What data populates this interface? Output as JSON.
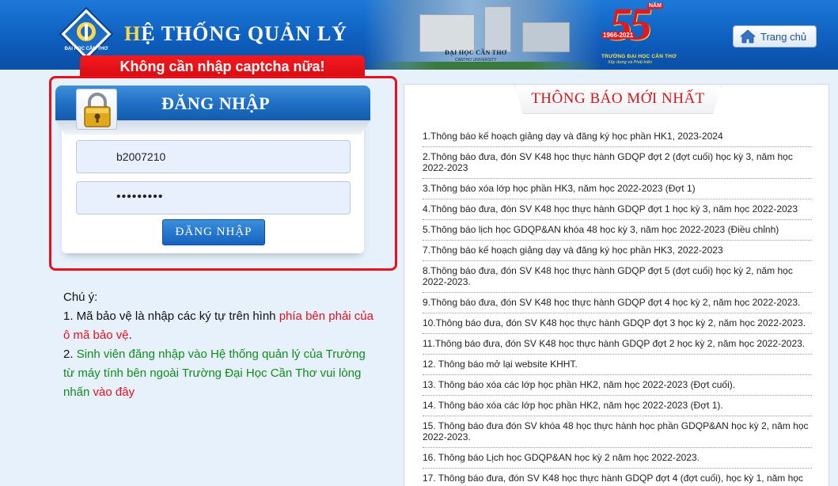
{
  "header": {
    "title_first": "H",
    "title_rest": "Ệ THỐNG QUẢN LÝ",
    "photo_sign": "ĐẠI HỌC CẦN THƠ",
    "photo_sub": "CANTHO UNIVERSITY",
    "anniversary": {
      "number": "55",
      "badge": "NĂM",
      "years": "1966-2021",
      "caption": "TRƯỜNG ĐẠI HỌC CẦN THƠ",
      "slogan": "Xây dựng và Phát triển"
    },
    "home_button": {
      "label": "Trang chủ",
      "icon": "home-icon"
    },
    "logo": {
      "text": "ĐẠI HỌC CẦN THƠ"
    }
  },
  "ribbon": {
    "text": "Không cần nhập captcha nữa!"
  },
  "login": {
    "title": "ĐĂNG NHẬP",
    "username_value": "b2007210",
    "password_value": "•••••••••",
    "submit_label": "ĐĂNG NHẬP",
    "icon": "padlock-icon"
  },
  "notes": {
    "heading": "Chú ý:",
    "n1_prefix": "1. Mã bảo vệ là nhập các ký tự trên hình ",
    "n1_red": "phía bên phải của ô mã bảo vệ",
    "n1_end": ".",
    "n2_prefix": "2. ",
    "n2_green": "Sinh viên đăng nhập vào Hệ thống quản lý của Trường từ máy tính bên ngoài Trường Đại Học Cần Thơ vui lòng nhấn ",
    "n2_link": "vào đây"
  },
  "announcements": {
    "title": "THÔNG BÁO MỚI NHẤT",
    "items": [
      "1.Thông báo kế hoạch giảng dạy và đăng ký học phần HK1, 2023-2024",
      "2.Thông báo đưa, đón SV K48 học thực hành GDQP đợt 2 (đợt cuối) học kỳ 3, năm học 2022-2023",
      "3.Thông báo xóa lớp học phần HK3, năm học 2022-2023 (Đợt 1)",
      "4.Thông báo đưa, đón SV K48 học thực hành GDQP đợt 1 học kỳ 3, năm học 2022-2023",
      "5.Thông báo lịch học GDQP&AN khóa 48 học kỳ 3, năm học 2022-2023 (Điều chỉnh)",
      "7.Thông báo kế hoạch giảng dạy và đăng ký học phần HK3, 2022-2023",
      "8.Thông báo đưa, đón SV K48 học thực hành GDQP đợt 5 (đợt cuối) học kỳ 2, năm học 2022-2023.",
      "9.Thông báo đưa, đón SV K48 học thực hành GDQP đợt 4 học kỳ 2, năm học 2022-2023.",
      "10.Thông báo đưa, đón SV K48 học thực hành GDQP đợt 3 học kỳ 2, năm học 2022-2023.",
      "11.Thông báo đưa, đón SV K48 học thực hành GDQP đợt 2 học kỳ 2, năm học 2022-2023.",
      "12. Thông báo mở lại website KHHT.",
      "13. Thông báo xóa các lớp học phần HK2, năm học 2022-2023 (Đợt cuối).",
      "14. Thông báo xóa các lớp học phần HK2, năm học 2022-2023 (Đợt 1).",
      "15. Thông báo đưa đón SV khóa 48 học thực hành học phần GDQP&AN học kỳ 2, năm học 2022-2023.",
      "16. Thông báo Lịch học GDQP&AN học kỳ 2 năm học 2022-2023.",
      "17. Thông báo đưa, đón SV K48 học thực hành GDQP đợt 4 (đợt cuối), học kỳ 1, năm học"
    ]
  },
  "colors": {
    "header_blue": "#0e5fbf",
    "ribbon_red": "#e60f1d",
    "accent_green": "#118c1b",
    "page_bg": "#e6f1fb"
  }
}
